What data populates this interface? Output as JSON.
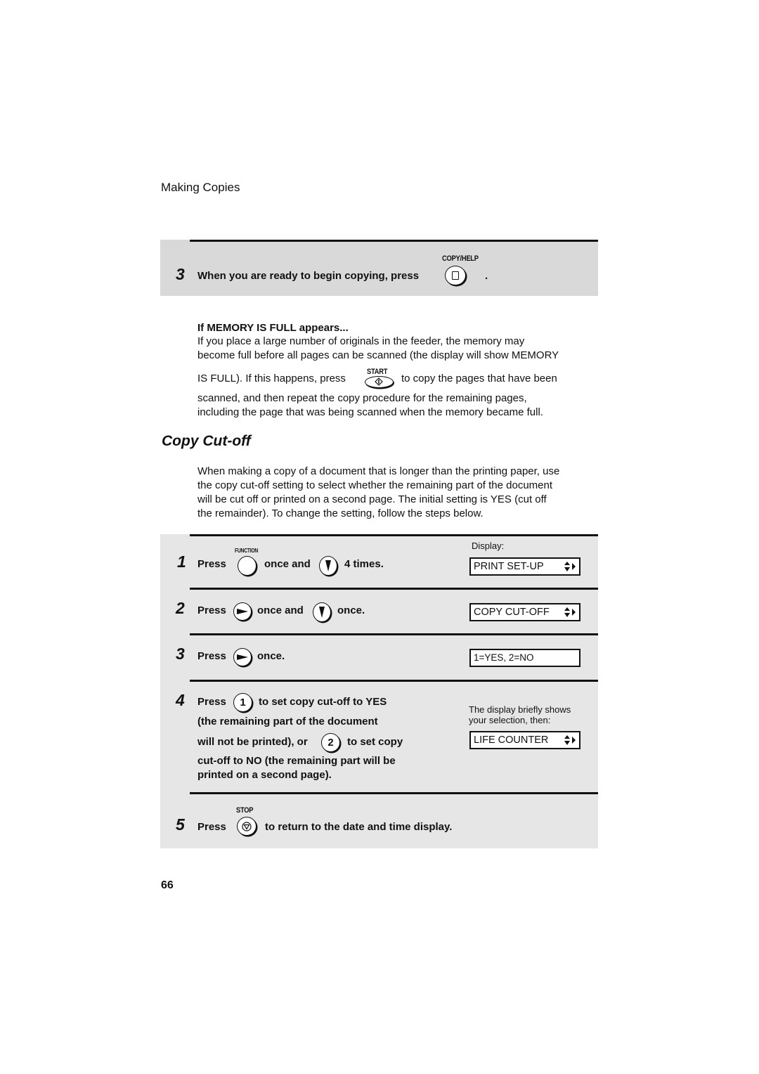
{
  "header": {
    "section_title": "Making Copies"
  },
  "step3_top": {
    "number": "3",
    "text": "When you are ready to begin copying, press",
    "trailing": ".",
    "button_label": "COPY/HELP",
    "button_icon": "copy-page-icon"
  },
  "memory_full": {
    "heading": "If MEMORY IS FULL appears...",
    "line1": "If you place a large number of originals in the feeder, the memory may",
    "line2": "become full before all pages can be scanned (the display will show MEMORY",
    "line3a": "IS FULL). If this happens, press",
    "line3b": "to copy the pages that have been",
    "start_label": "START",
    "line4": "scanned, and then repeat the copy procedure for the remaining pages,",
    "line5": "including the page that was being scanned when the memory became full."
  },
  "copy_cutoff": {
    "title": "Copy Cut-off",
    "intro": [
      "When making a copy of a document that is longer than the printing paper, use",
      "the copy cut-off setting to select whether the remaining part of the document",
      "will be cut off or printed on a second page. The initial setting is YES (cut off",
      "the remainder). To change the setting, follow the steps below."
    ],
    "display_label": "Display:",
    "steps": [
      {
        "number": "1",
        "press": "Press",
        "button_label": "FUNCTION",
        "mid": "once and",
        "end": "4 times.",
        "display": "PRINT SET-UP"
      },
      {
        "number": "2",
        "press": "Press",
        "mid": "once and",
        "end": "once.",
        "display": "COPY CUT-OFF"
      },
      {
        "number": "3",
        "press": "Press",
        "end": "once.",
        "display": "1=YES, 2=NO"
      },
      {
        "number": "4",
        "press": "Press",
        "key1": "1",
        "line1": "to set copy cut-off to YES",
        "line2": "(the remaining part of the document",
        "line3a": "will not be printed), or",
        "key2": "2",
        "line3b": "to set copy",
        "line4": "cut-off to NO (the remaining part will be",
        "line5": "printed on a second page).",
        "note1": "The display briefly shows",
        "note2": "your selection, then:",
        "display": "LIFE COUNTER"
      },
      {
        "number": "5",
        "press": "Press",
        "button_label": "STOP",
        "end": "to return to the date and time display."
      }
    ]
  },
  "footer": {
    "page_number": "66"
  }
}
